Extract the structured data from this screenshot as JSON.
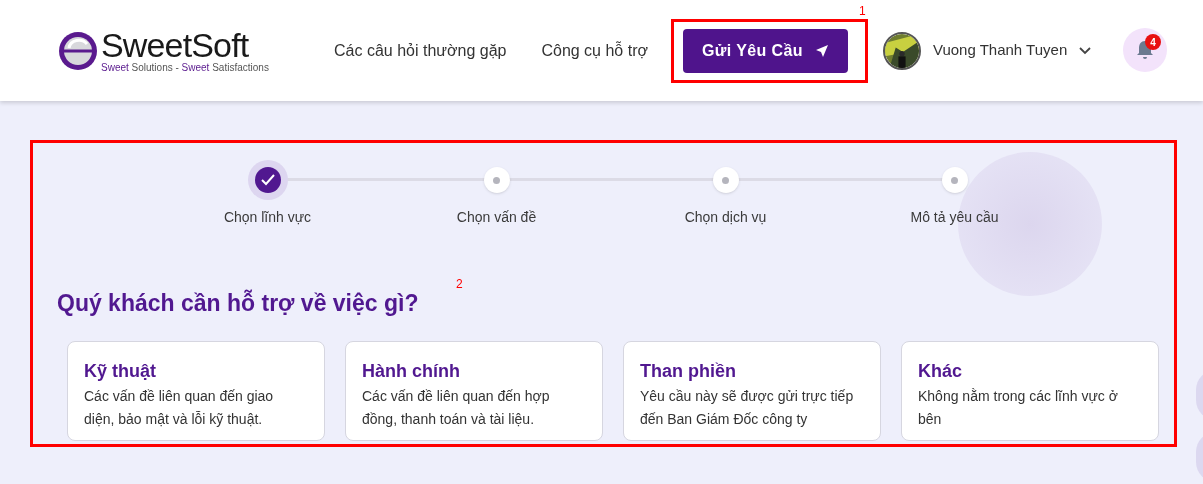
{
  "header": {
    "logo": {
      "wordmark": "SweetSoft",
      "tagline": [
        {
          "text": "Sweet",
          "accent": true
        },
        {
          "text": " Solutions - ",
          "accent": false
        },
        {
          "text": "Sweet",
          "accent": true
        },
        {
          "text": " Satisfactions",
          "accent": false
        }
      ]
    },
    "nav": [
      "Các câu hỏi thường gặp",
      "Công cụ hỗ trợ"
    ],
    "request_button": "Gửi Yêu Cầu",
    "user": {
      "name": "Vuong Thanh Tuyen"
    },
    "notifications": {
      "count": "4"
    }
  },
  "steps": [
    {
      "label": "Chọn lĩnh vực",
      "done": true
    },
    {
      "label": "Chọn vấn đề",
      "done": false
    },
    {
      "label": "Chọn dịch vụ",
      "done": false
    },
    {
      "label": "Mô tả yêu cầu",
      "done": false
    }
  ],
  "heading": "Quý khách cần hỗ trợ về việc gì?",
  "categories": [
    {
      "title": "Kỹ thuật",
      "description": "Các vấn đề liên quan đến giao diện, bảo mật và lỗi kỹ thuật."
    },
    {
      "title": "Hành chính",
      "description": "Các vấn đề liên quan đến hợp đồng, thanh toán và tài liệu."
    },
    {
      "title": "Than phiền",
      "description": "Yêu cầu này sẽ được gửi trực tiếp đến Ban Giám Đốc công ty"
    },
    {
      "title": "Khác",
      "description": "Không nằm trong các lĩnh vực ở bên"
    }
  ],
  "annotations": [
    {
      "label": "1"
    },
    {
      "label": "2"
    }
  ]
}
